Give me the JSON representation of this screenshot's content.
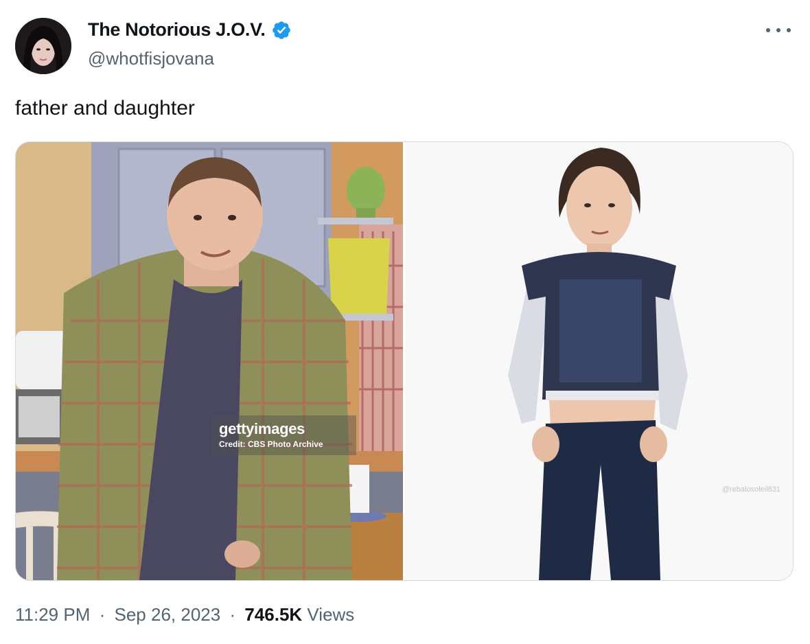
{
  "author": {
    "display_name": "The Notorious J.O.V.",
    "handle": "@whotfisjovana",
    "verified": true,
    "verified_color": "#1d9bf0"
  },
  "tweet": {
    "text": "father and daughter"
  },
  "media": {
    "left_watermark": {
      "logo": "gettyimages",
      "credit": "Credit: CBS Photo Archive"
    },
    "right_watermark": "@rebalosoleil831"
  },
  "footer": {
    "time": "11:29 PM",
    "separator": "·",
    "date": "Sep 26, 2023",
    "views_count": "746.5K",
    "views_label": "Views"
  },
  "icons": {
    "verified": "verified-badge-icon",
    "more": "more-options-icon"
  }
}
